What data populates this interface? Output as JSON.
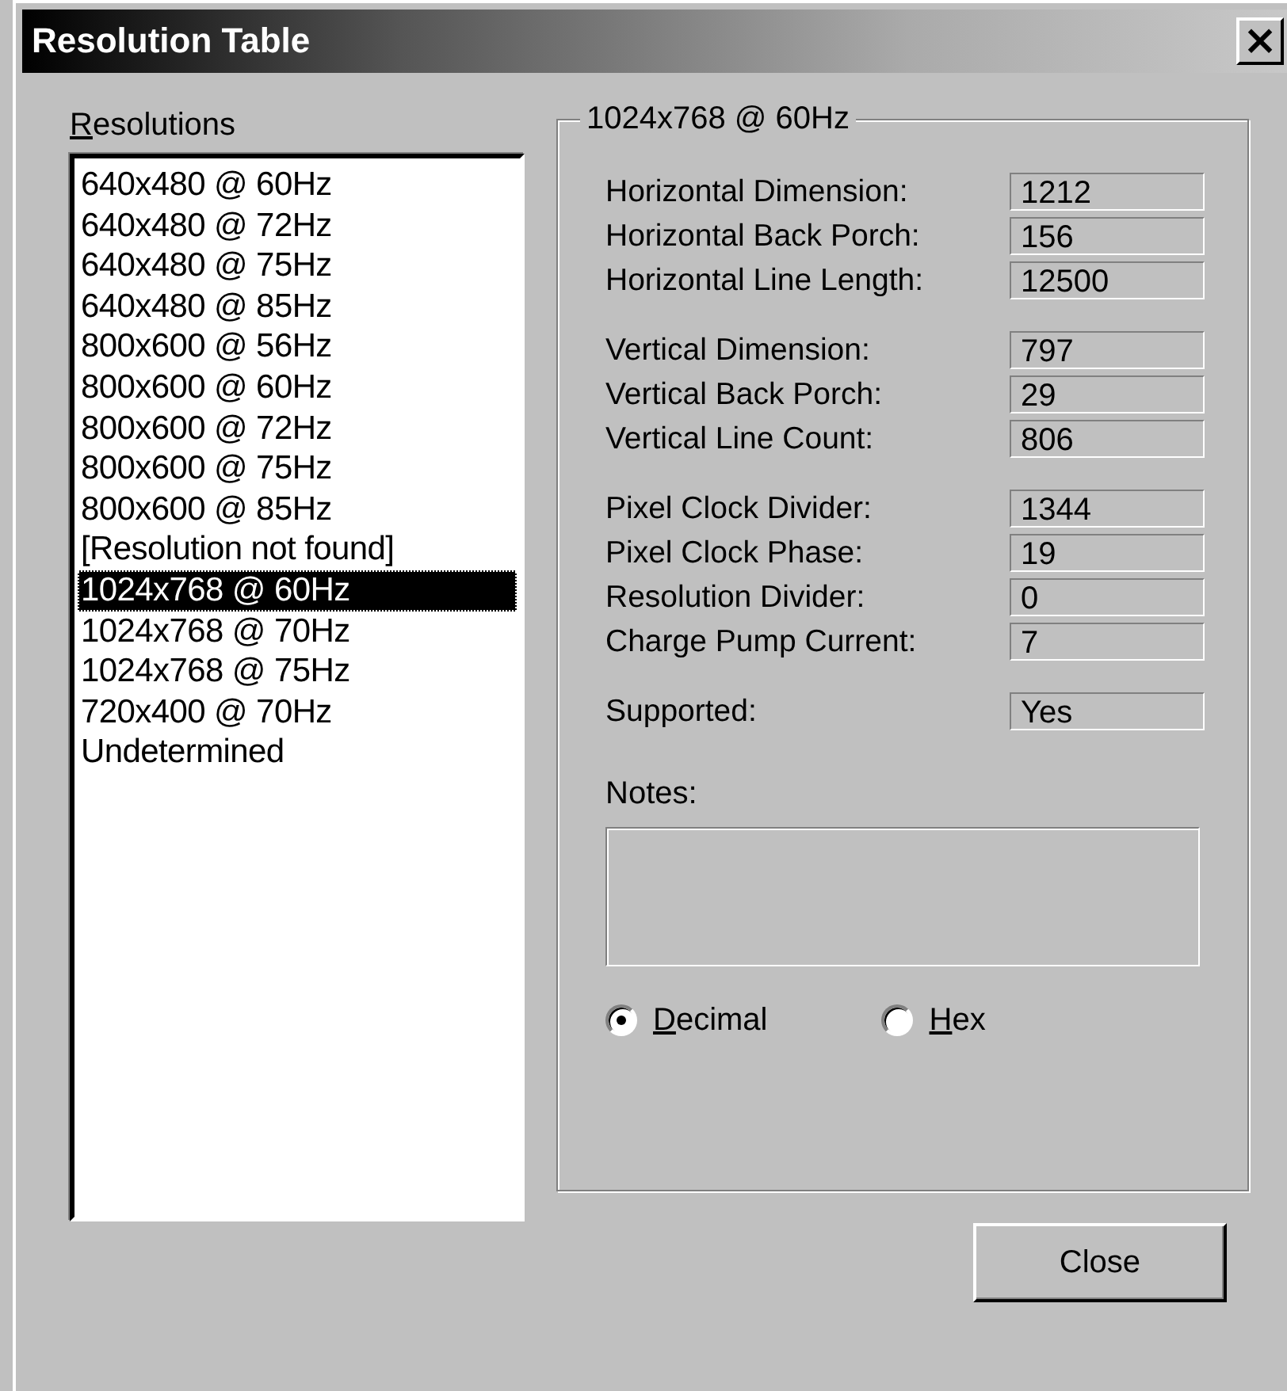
{
  "window": {
    "title": "Resolution Table",
    "close": "×"
  },
  "resolutions": {
    "label_key": "R",
    "label_rest": "esolutions",
    "items": [
      {
        "label": "640x480 @ 60Hz",
        "selected": false
      },
      {
        "label": "640x480 @ 72Hz",
        "selected": false
      },
      {
        "label": "640x480 @ 75Hz",
        "selected": false
      },
      {
        "label": "640x480 @ 85Hz",
        "selected": false
      },
      {
        "label": "800x600 @ 56Hz",
        "selected": false
      },
      {
        "label": "800x600 @ 60Hz",
        "selected": false
      },
      {
        "label": "800x600 @ 72Hz",
        "selected": false
      },
      {
        "label": "800x600 @ 75Hz",
        "selected": false
      },
      {
        "label": "800x600 @ 85Hz",
        "selected": false
      },
      {
        "label": "[Resolution not found]",
        "selected": false
      },
      {
        "label": "1024x768 @ 60Hz",
        "selected": true
      },
      {
        "label": "1024x768 @ 70Hz",
        "selected": false
      },
      {
        "label": "1024x768 @ 75Hz",
        "selected": false
      },
      {
        "label": "720x400 @ 70Hz",
        "selected": false
      },
      {
        "label": "Undetermined",
        "selected": false
      }
    ]
  },
  "details": {
    "title": "1024x768 @ 60Hz",
    "groups": [
      [
        {
          "label": "Horizontal Dimension:",
          "value": "1212"
        },
        {
          "label": "Horizontal Back Porch:",
          "value": "156"
        },
        {
          "label": "Horizontal Line Length:",
          "value": "12500"
        }
      ],
      [
        {
          "label": "Vertical Dimension:",
          "value": "797"
        },
        {
          "label": "Vertical Back Porch:",
          "value": "29"
        },
        {
          "label": "Vertical Line Count:",
          "value": "806"
        }
      ],
      [
        {
          "label": "Pixel Clock Divider:",
          "value": "1344"
        },
        {
          "label": "Pixel Clock Phase:",
          "value": "19"
        },
        {
          "label": "Resolution Divider:",
          "value": "0"
        },
        {
          "label": "Charge Pump Current:",
          "value": "7"
        }
      ],
      [
        {
          "label": "Supported:",
          "value": "Yes"
        }
      ]
    ],
    "notes_label": "Notes:",
    "format": [
      {
        "key": "D",
        "rest": "ecimal",
        "selected": true
      },
      {
        "key": "H",
        "rest": "ex",
        "selected": false
      }
    ]
  },
  "buttons": [
    "Close"
  ]
}
